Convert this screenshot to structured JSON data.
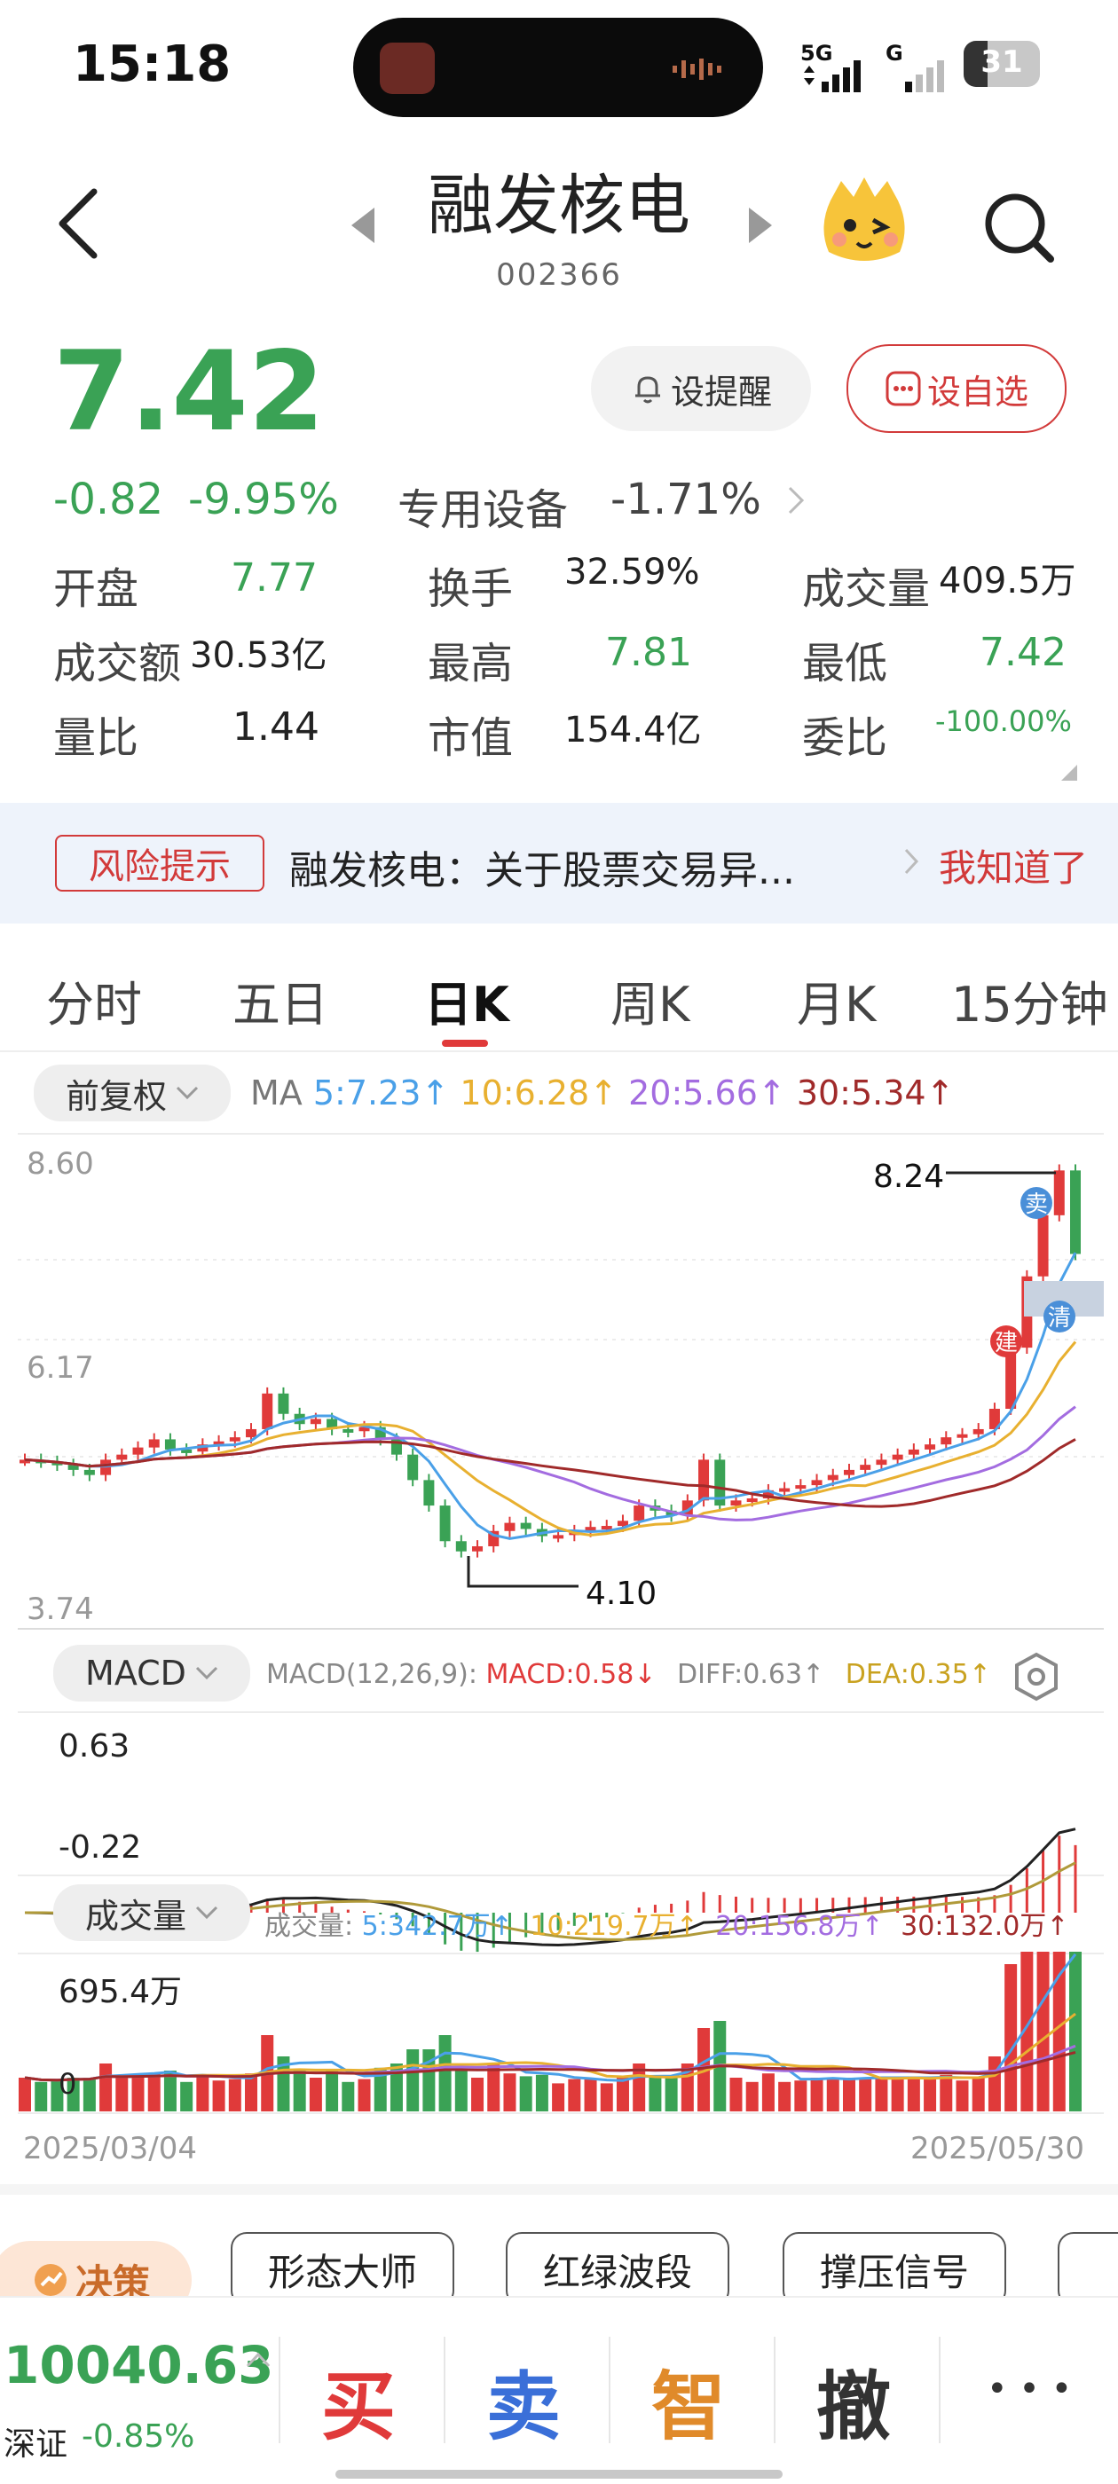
{
  "status": {
    "time": "15:18",
    "network": "5G",
    "network2": "G",
    "battery": "31"
  },
  "stock": {
    "name": "融发核电",
    "code": "002366"
  },
  "quote": {
    "price": "7.42",
    "change": "-0.82",
    "change_pct": "-9.95%",
    "sector": "专用设备",
    "sector_pct": "-1.71%",
    "alert_label": "设提醒",
    "watch_label": "设自选"
  },
  "stats": {
    "open_label": "开盘",
    "open": "7.77",
    "turnover_label": "换手",
    "turnover": "32.59%",
    "volume_label": "成交量",
    "volume": "409.5万",
    "amount_label": "成交额",
    "amount": "30.53亿",
    "high_label": "最高",
    "high": "7.81",
    "low_label": "最低",
    "low": "7.42",
    "ratio_label": "量比",
    "ratio": "1.44",
    "mcap_label": "市值",
    "mcap": "154.4亿",
    "commission_label": "委比",
    "commission": "-100.00%"
  },
  "risk": {
    "tag": "风险提示",
    "text": "融发核电：关于股票交易异...",
    "ok": "我知道了"
  },
  "tabs": [
    "分时",
    "五日",
    "日K",
    "周K",
    "月K",
    "15分钟"
  ],
  "chart": {
    "adjust_label": "前复权",
    "ma_prefix": "MA",
    "ma5": "5:7.23↑",
    "ma10": "10:6.28↑",
    "ma20": "20:5.66↑",
    "ma30": "30:5.34↑",
    "y_max": "8.60",
    "y_mid": "6.17",
    "y_min": "3.74",
    "high_mark": "8.24",
    "low_mark": "4.10",
    "tag_sell": "卖",
    "tag_clear": "清",
    "tag_build": "建",
    "macd_label": "MACD",
    "macd_params": "MACD(12,26,9):",
    "macd_val": "MACD:0.58↓",
    "diff_val": "DIFF:0.63↑",
    "dea_val": "DEA:0.35↑",
    "macd_top": "0.63",
    "macd_bottom": "-0.22",
    "vol_label": "成交量",
    "vol_prefix": "成交量:",
    "vol5": "5:342.7万↑",
    "vol10": "10:219.7万↑",
    "vol20": "20:156.8万↑",
    "vol30": "30:132.0万↑",
    "vol_top": "695.4万",
    "vol_zero": "0",
    "date_start": "2025/03/04",
    "date_end": "2025/05/30"
  },
  "tools": {
    "decision": "决策",
    "items": [
      "形态大师",
      "红绿波段",
      "撑压信号"
    ]
  },
  "bottom": {
    "index_value": "10040.63",
    "index_name": "深证",
    "index_change": "-0.85%",
    "buy": "买",
    "sell": "卖",
    "smart": "智",
    "cancel": "撤",
    "more": "• • •"
  },
  "colors": {
    "up": "#e03a3a",
    "down": "#3aa255",
    "ma5": "#4aa0e8",
    "ma10": "#e8b030",
    "ma20": "#a36ce0",
    "ma30": "#a02a2a"
  }
}
